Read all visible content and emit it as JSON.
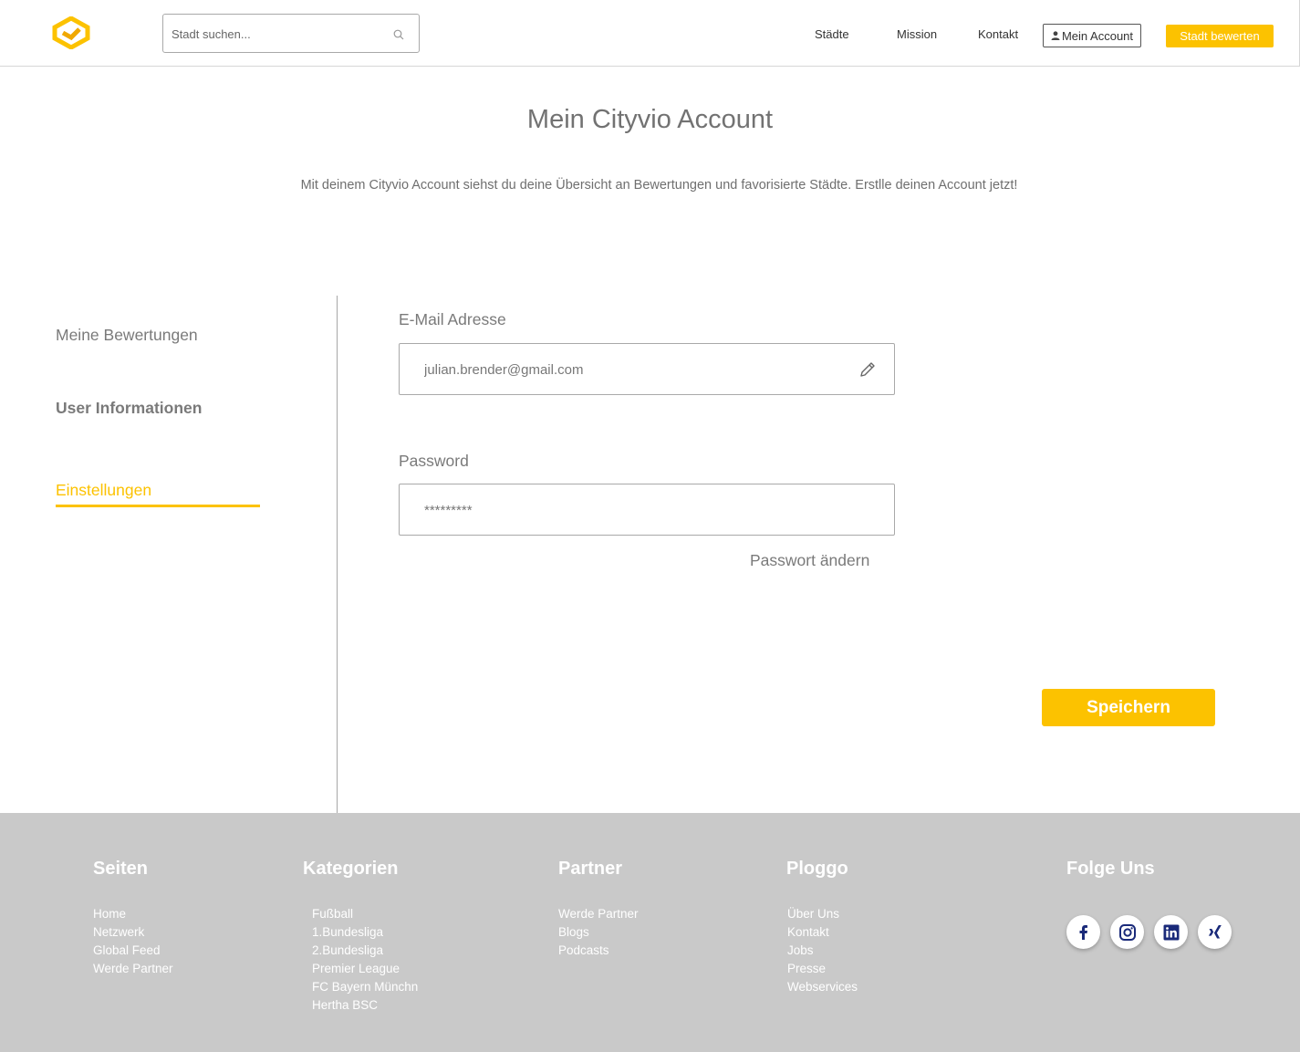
{
  "header": {
    "search_placeholder": "Stadt suchen...",
    "nav": [
      "Städte",
      "Mission",
      "Kontakt"
    ],
    "account_label": "Mein Account",
    "rate_label": "Stadt bewerten"
  },
  "title": "Mein Cityvio Account",
  "subtitle": "Mit deinem Cityvio Account siehst du deine Übersicht an Bewertungen und favorisierte Städte. Erstlle deinen Account jetzt!",
  "sidebar": {
    "items": [
      {
        "label": "Meine Bewertungen"
      },
      {
        "label": "User Informationen"
      },
      {
        "label": "Einstellungen"
      }
    ]
  },
  "form": {
    "email_label": "E-Mail Adresse",
    "email_value": "julian.brender@gmail.com",
    "password_label": "Password",
    "password_value": "*********",
    "change_password": "Passwort ändern",
    "save_label": "Speichern"
  },
  "footer": {
    "columns": [
      {
        "title": "Seiten",
        "links": [
          "Home",
          "Netzwerk",
          "Global Feed",
          "Werde Partner"
        ]
      },
      {
        "title": "Kategorien",
        "links": [
          "Fußball",
          "1.Bundesliga",
          "2.Bundesliga",
          "Premier League",
          "FC Bayern Münchn",
          "Hertha BSC"
        ]
      },
      {
        "title": "Partner",
        "links": [
          "Werde Partner",
          "Blogs",
          "Podcasts"
        ]
      },
      {
        "title": "Ploggo",
        "links": [
          "Über Uns",
          "Kontakt",
          "Jobs",
          "Presse",
          "Webservices"
        ]
      }
    ],
    "social_title": "Folge Uns",
    "social": [
      "facebook-icon",
      "instagram-icon",
      "linkedin-icon",
      "xing-icon"
    ]
  },
  "colors": {
    "accent": "#fcc200",
    "footer_bg": "#c9c9c9",
    "social_icon": "#1a2a7a"
  }
}
